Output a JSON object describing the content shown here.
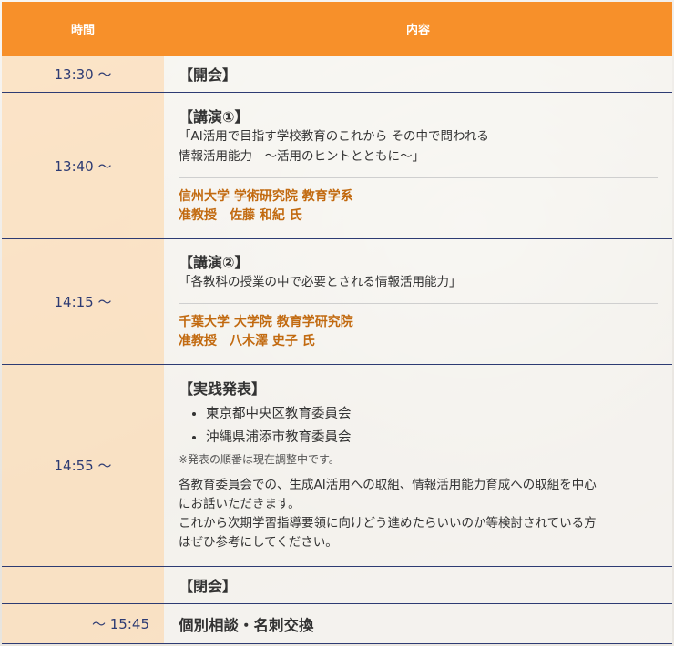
{
  "header": {
    "time_label": "時間",
    "content_label": "内容"
  },
  "rows": [
    {
      "time": "13:30 ～",
      "title": "【開会】"
    },
    {
      "time": "13:40 ～",
      "title": "【講演①】",
      "quote_line1": "「AI活用で目指す学校教育のこれから その中で問われる",
      "quote_line2": "情報活用能力　～活用のヒントとともに～」",
      "speaker_line1": "信州大学 学術研究院 教育学系",
      "speaker_line2": "准教授　佐藤 和紀 氏"
    },
    {
      "time": "14:15 ～",
      "title": "【講演②】",
      "quote_line1": "「各教科の授業の中で必要とされる情報活用能力」",
      "speaker_line1": "千葉大学 大学院 教育学研究院",
      "speaker_line2": "准教授　八木澤 史子 氏"
    },
    {
      "time": "14:55 ～",
      "title": "【実践発表】",
      "bullets": [
        "東京都中央区教育委員会",
        "沖縄県浦添市教育委員会"
      ],
      "note": "※発表の順番は現在調整中です。",
      "desc_line1": "各教育委員会での、生成AI活用への取組、情報活用能力育成への取組を中心",
      "desc_line2": "にお話いただきます。",
      "desc_line3": "これから次期学習指導要領に向けどう進めたらいいのか等検討されている方",
      "desc_line4": "はぜひ参考にしてください。"
    },
    {
      "time": "",
      "title": "【閉会】"
    },
    {
      "time": "～ 15:45",
      "title": "個別相談・名刺交換"
    }
  ],
  "colors": {
    "header_bg": "#f7902a",
    "time_text": "#2d3b73",
    "speaker_text": "#c26a10",
    "time_cell_bg": "#fce0c0"
  }
}
